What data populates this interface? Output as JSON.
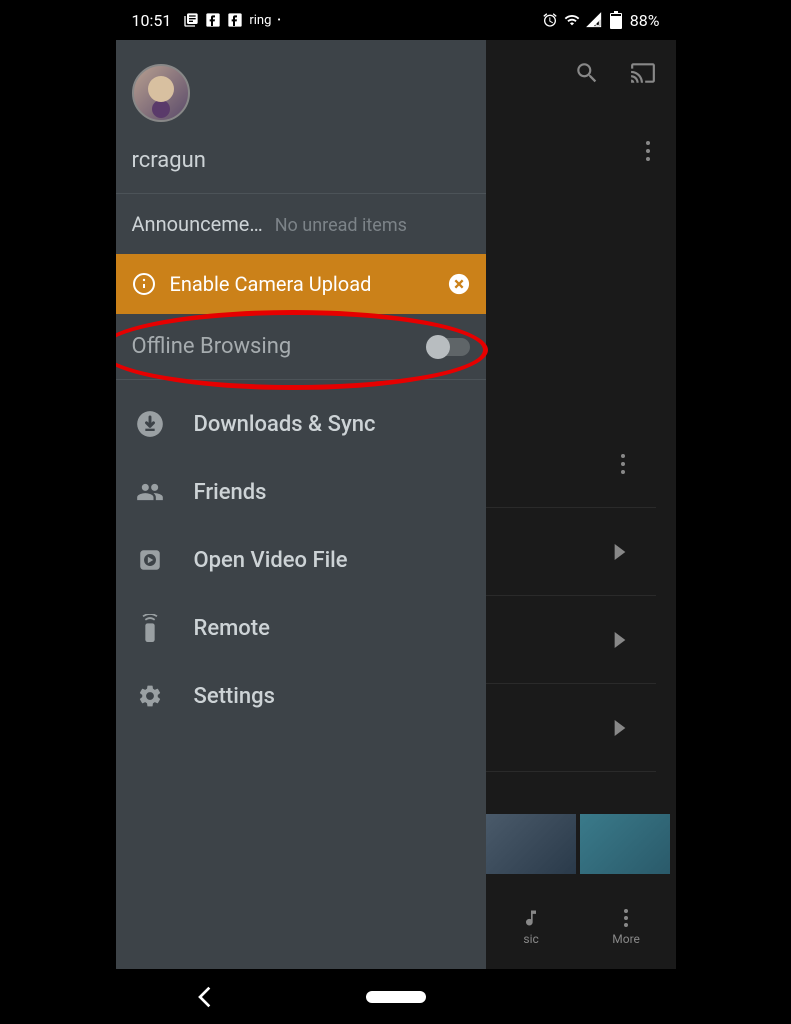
{
  "statusbar": {
    "time": "10:51",
    "ring_label": "ring",
    "battery": "88%"
  },
  "drawer": {
    "username": "rcragun",
    "announcements": {
      "label": "Announceme…",
      "status": "No unread items"
    },
    "camera_upload": "Enable Camera Upload",
    "offline": "Offline Browsing",
    "menu": {
      "downloads": "Downloads & Sync",
      "friends": "Friends",
      "open_video": "Open Video File",
      "remote": "Remote",
      "settings": "Settings"
    }
  },
  "bottomnav": {
    "music": "sic",
    "more": "More"
  }
}
